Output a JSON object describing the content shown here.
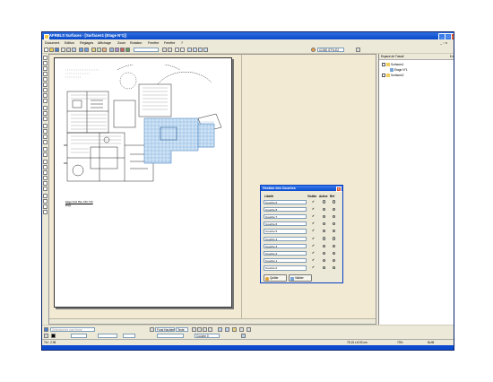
{
  "window": {
    "title": "AFRBLS Surfaces - [Surfaces1 (Etage N°1)]",
    "controls": {
      "minimize": "_",
      "maximize": "□",
      "close": "x"
    }
  },
  "menu": {
    "items": [
      "Document",
      "Edition",
      "Réglages",
      "Affichage",
      "Zoom",
      "Rotation",
      "Fenêtre",
      "Fenêtre",
      "?"
    ],
    "mdi_controls": "_ ▫ x"
  },
  "toolbar": {
    "style_label": "CODE STYLE2"
  },
  "drawing": {
    "caption": "Etage Nord Plan 1/50 T-50",
    "caption2": "Etage"
  },
  "layers_dialog": {
    "title": "Gestion des Couches",
    "close": "x",
    "headers": {
      "label": "Libellé",
      "visible": "Visible",
      "active": "Active",
      "ref": "Ref"
    },
    "rows": [
      {
        "name": "Couche 0",
        "visible": true,
        "active": false,
        "ref": false
      },
      {
        "name": "Couche 8",
        "visible": true,
        "active": false,
        "ref": false
      },
      {
        "name": "Couche 7",
        "visible": true,
        "active": false,
        "ref": false
      },
      {
        "name": "Couche 6",
        "visible": true,
        "active": false,
        "ref": false
      },
      {
        "name": "Couche 5",
        "visible": true,
        "active": false,
        "ref": false
      },
      {
        "name": "Couche 4",
        "visible": true,
        "active": false,
        "ref": false
      },
      {
        "name": "Couche 3",
        "visible": true,
        "active": false,
        "ref": false
      },
      {
        "name": "Couche 2",
        "visible": true,
        "active": false,
        "ref": false
      },
      {
        "name": "Couche 1",
        "visible": true,
        "active": false,
        "ref": false
      },
      {
        "name": "Couche 0",
        "visible": true,
        "active": true,
        "ref": true
      }
    ],
    "quit_label": "Quitter",
    "validate_label": "Valider"
  },
  "workspace": {
    "title": "Espace de Travail",
    "pin": "ʬ x",
    "items": [
      "Surfaces1",
      "Etage N°1",
      "Surfaces2"
    ]
  },
  "bottom_toolbar": {
    "search_placeholder": "Sélectionnez une forme",
    "pattern": "Fond Hachée",
    "text_label": "Texte",
    "layer_value": "Couche 0"
  },
  "status": {
    "left": "Tél : 2.95",
    "coords": "75.15 x 8.00 cm",
    "zoom": "73%",
    "mode": "NUM"
  }
}
